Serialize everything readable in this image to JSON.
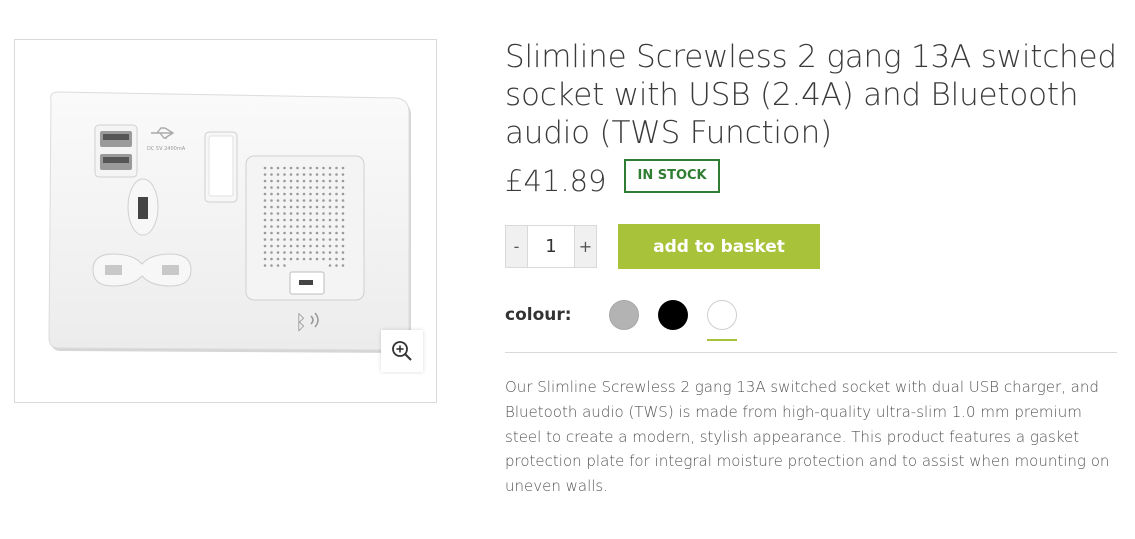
{
  "product": {
    "title": "Slimline Screwless 2 gang 13A switched socket with USB (2.4A) and Bluetooth audio (TWS Function)",
    "price": "£41.89",
    "stock_status": "IN STOCK",
    "quantity": {
      "decrement": "-",
      "value": "1",
      "increment": "+"
    },
    "add_to_basket": "add to basket",
    "colour_label": "colour:",
    "colours": [
      {
        "name": "grey",
        "hex": "#b3b3b3",
        "selected": false
      },
      {
        "name": "black",
        "hex": "#000000",
        "selected": false
      },
      {
        "name": "white",
        "hex": "#ffffff",
        "selected": true
      }
    ],
    "description": "Our Slimline Screwless 2 gang 13A switched socket with dual USB charger, and Bluetooth audio (TWS) is made from high-quality ultra-slim 1.0 mm premium steel to create a modern, stylish appearance. This product features a gasket protection plate for integral moisture protection and to assist when mounting on uneven walls.",
    "image_caption": "DC 5V 2400mA"
  },
  "colors": {
    "accent": "#a8c23a",
    "stock": "#2e7d32"
  },
  "icons": {
    "zoom": "zoom-in-icon",
    "usb": "usb-icon",
    "bluetooth": "bluetooth-icon"
  }
}
